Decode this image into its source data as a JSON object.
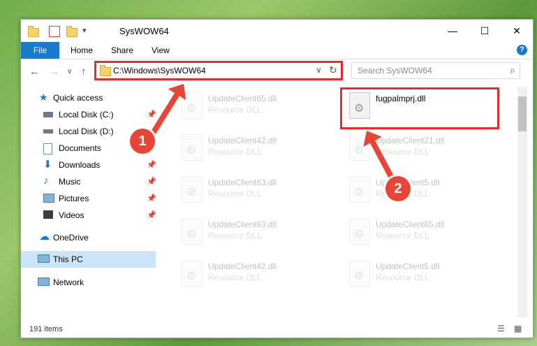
{
  "window": {
    "title": "SysWOW64",
    "buttons": {
      "minimize": "—",
      "maximize": "☐",
      "close": "✕"
    }
  },
  "ribbon": {
    "file": "File",
    "tabs": [
      "Home",
      "Share",
      "View"
    ],
    "help": "?"
  },
  "nav": {
    "back": "←",
    "forward": "→",
    "dropdown": "∨",
    "up": "↑",
    "address": "C:\\Windows\\SysWOW64",
    "refresh": "↻",
    "search_placeholder": "Search SysWOW64",
    "search_icon": "⌕"
  },
  "sidebar": {
    "items": [
      {
        "label": "Quick access"
      },
      {
        "label": "Local Disk (C:)"
      },
      {
        "label": "Local Disk (D:)"
      },
      {
        "label": "Documents"
      },
      {
        "label": "Downloads"
      },
      {
        "label": "Music"
      },
      {
        "label": "Pictures"
      },
      {
        "label": "Videos"
      },
      {
        "label": "OneDrive"
      },
      {
        "label": "This PC"
      },
      {
        "label": "Network"
      }
    ]
  },
  "files": [
    {
      "name": "UpdateClient65.dll",
      "type": "Resource DLL"
    },
    {
      "name": "fugpalmprj.dll",
      "type": ""
    },
    {
      "name": "UpdateClient42.dll",
      "type": "Resource DLL"
    },
    {
      "name": "UpdateClient21.dll",
      "type": "Resource DLL"
    },
    {
      "name": "UpdateClient63.dll",
      "type": "Resource DLL"
    },
    {
      "name": "UpdateClient5.dll",
      "type": "Resource DLL"
    },
    {
      "name": "UpdateClient63.dll",
      "type": "Resource DLL"
    },
    {
      "name": "UpdateClient65.dll",
      "type": "Resource DLL"
    },
    {
      "name": "UpdateClient42.dll",
      "type": "Resource DLL"
    },
    {
      "name": "UpdateClient5.dll",
      "type": "Resource DLL"
    }
  ],
  "status": {
    "items": "191 items"
  },
  "callouts": {
    "one": "1",
    "two": "2"
  },
  "colors": {
    "accent": "#1979ca",
    "annotation": "#e0302b"
  }
}
